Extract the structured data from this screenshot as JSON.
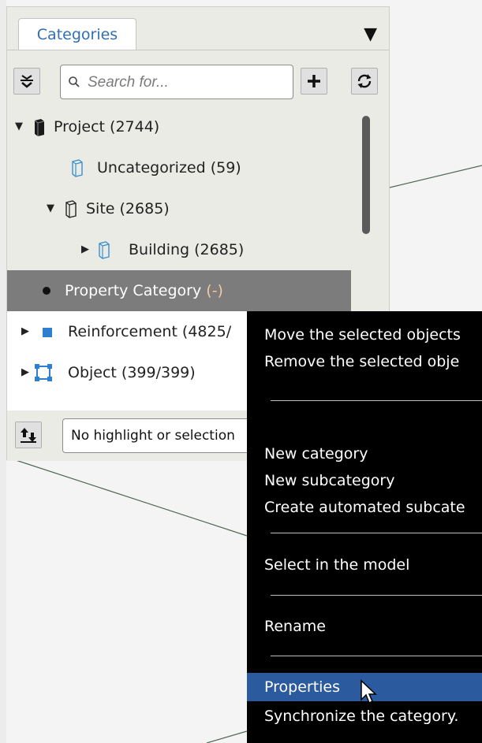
{
  "panel": {
    "tab_label": "Categories",
    "menu_icon": "triangle-down-icon",
    "search_placeholder": "Search for...",
    "collapse_icon": "collapse-all-icon",
    "add_icon": "plus-icon",
    "refresh_icon": "refresh-icon",
    "highlight_icon": "highlight-arrows-icon",
    "highlight_select_value": "No highlight or selection"
  },
  "tree": [
    {
      "label": "Project (2744)",
      "icon": "project-box-icon",
      "expanded": true
    },
    {
      "label": "Uncategorized (59)",
      "icon": "category-box-icon"
    },
    {
      "label": "Site (2685)",
      "icon": "site-box-icon",
      "expanded": true
    },
    {
      "label": "Building (2685)",
      "icon": "category-box-icon",
      "expanded": false
    },
    {
      "label_main": "Property Category",
      "label_count": "(-)",
      "icon": "bullet-icon",
      "selected": true
    },
    {
      "label": "Reinforcement (4825/",
      "icon": "blue-square-icon",
      "expanded": false
    },
    {
      "label": "Object (399/399)",
      "icon": "object-frame-icon",
      "expanded": false
    }
  ],
  "context_menu": {
    "items": [
      "Move the selected objects",
      "Remove the selected obje",
      "New category",
      "New subcategory",
      "Create automated subcate",
      "Select in the model",
      "Rename",
      "Properties",
      "Synchronize the category."
    ],
    "highlighted": "Properties"
  },
  "colors": {
    "accent_blue": "#2f6fb1",
    "selection_gray": "#7c7c7c",
    "menu_bg": "#000000",
    "menu_hover": "#2b5a9e"
  }
}
